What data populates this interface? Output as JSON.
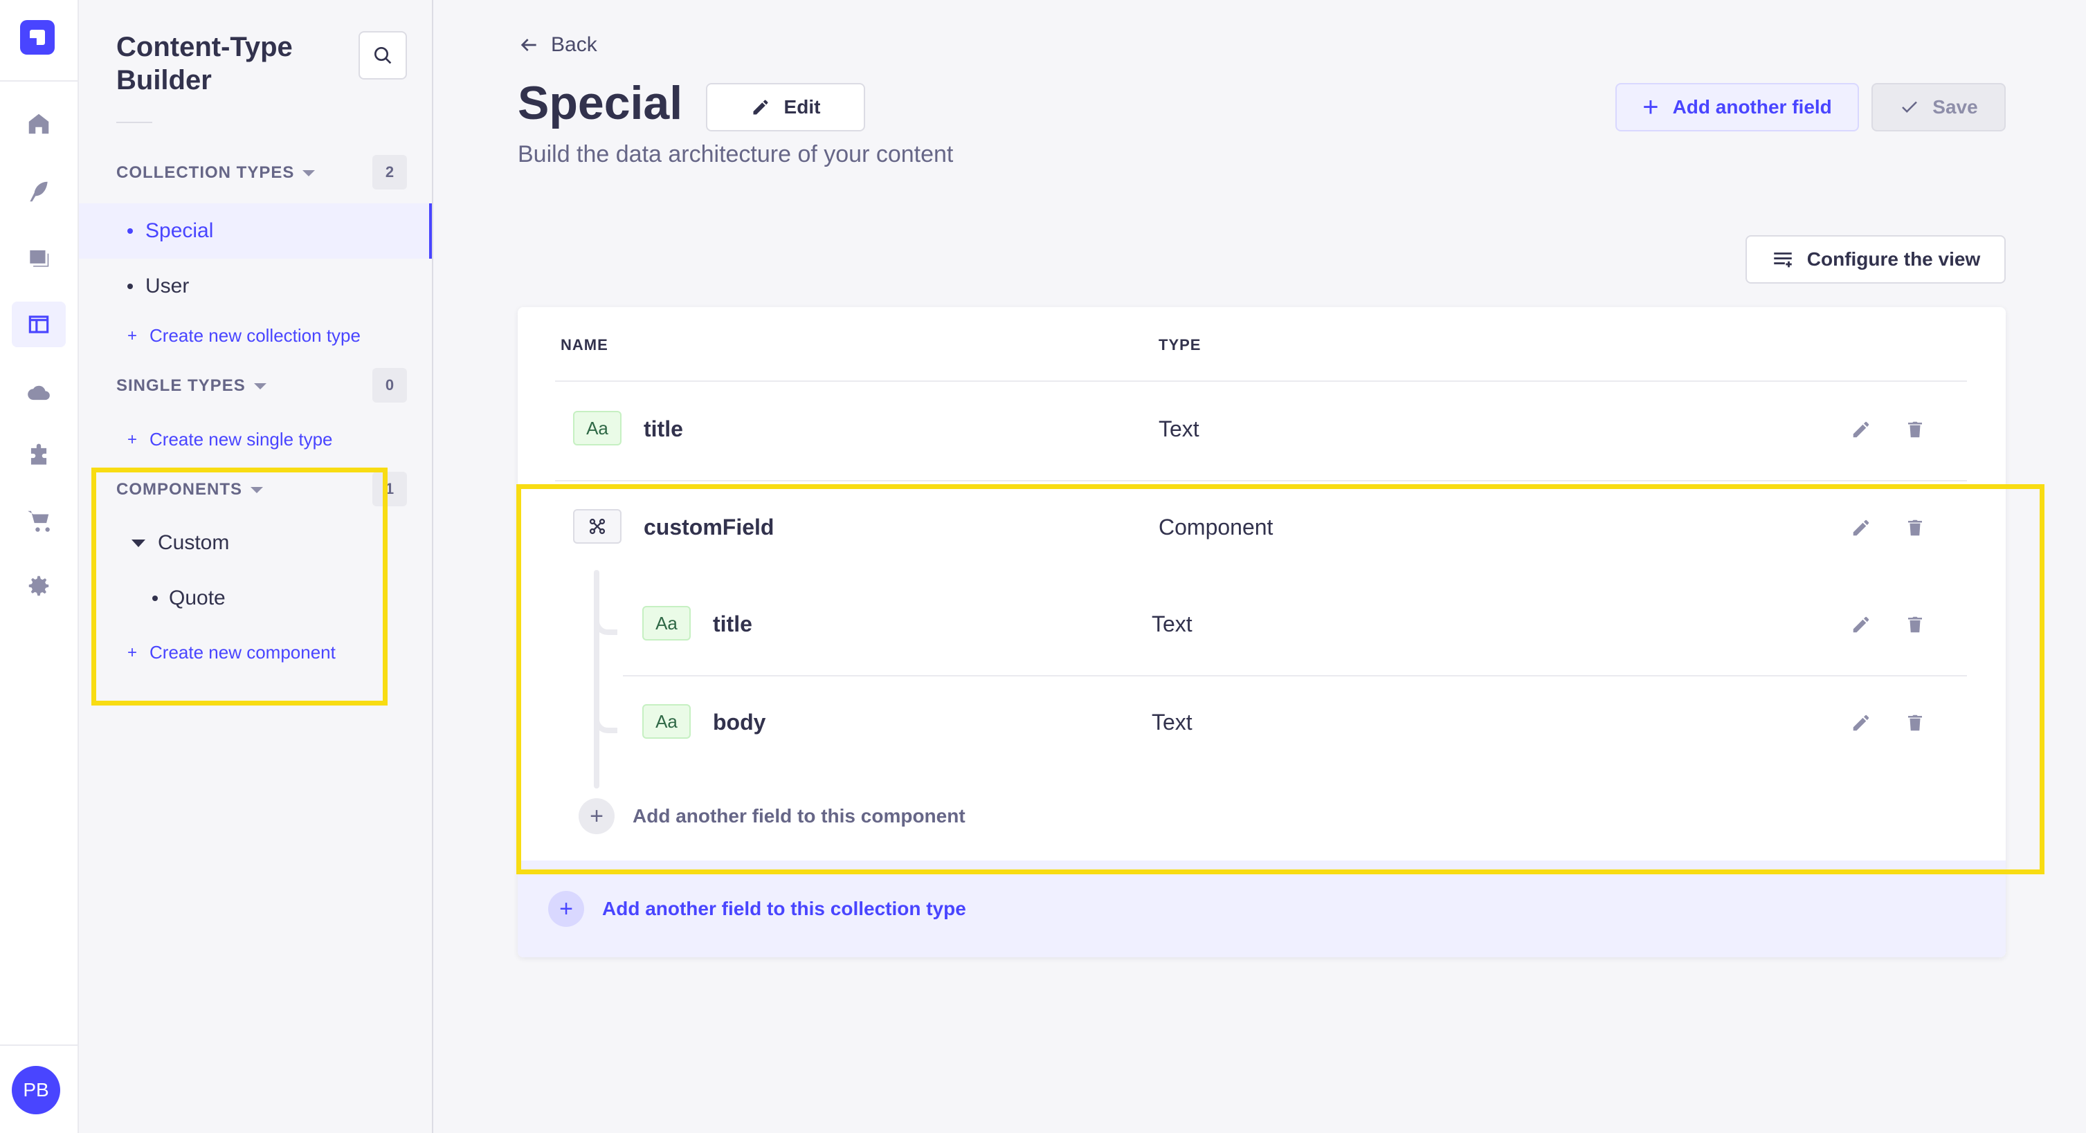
{
  "rail": {
    "avatar_initials": "PB",
    "icons": [
      "home-icon",
      "feather-icon",
      "media-library-icon",
      "layout-icon",
      "cloud-icon",
      "puzzle-icon",
      "cart-icon",
      "gear-icon"
    ]
  },
  "subnav": {
    "title": "Content-Type Builder",
    "collection_types": {
      "label": "COLLECTION TYPES",
      "count": "2",
      "items": [
        "Special",
        "User"
      ],
      "create_label": "Create new collection type"
    },
    "single_types": {
      "label": "SINGLE TYPES",
      "count": "0",
      "create_label": "Create new single type"
    },
    "components": {
      "label": "COMPONENTS",
      "count": "1",
      "group": "Custom",
      "items": [
        "Quote"
      ],
      "create_label": "Create new component"
    }
  },
  "header": {
    "back_label": "Back",
    "title": "Special",
    "edit_label": "Edit",
    "subtitle": "Build the data architecture of your content",
    "add_field_label": "Add another field",
    "save_label": "Save",
    "configure_label": "Configure the view"
  },
  "table": {
    "columns": [
      "NAME",
      "TYPE"
    ],
    "rows": [
      {
        "icon": "Aa",
        "name": "title",
        "type": "Text"
      },
      {
        "name": "customField",
        "type": "Component"
      }
    ],
    "component_rows": [
      {
        "icon": "Aa",
        "name": "title",
        "type": "Text"
      },
      {
        "icon": "Aa",
        "name": "body",
        "type": "Text"
      }
    ],
    "add_component_field_label": "Add another field to this component",
    "add_collection_field_label": "Add another field to this collection type"
  },
  "colors": {
    "primary": "#4945ff",
    "highlight": "#f8dc13",
    "text_badge_bg": "#eafbe7"
  }
}
